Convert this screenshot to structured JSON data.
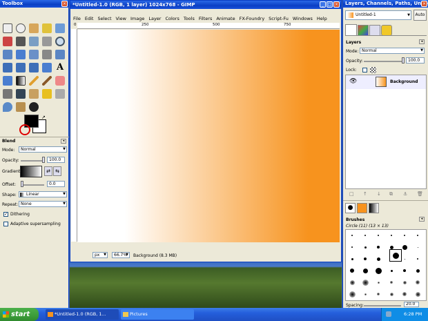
{
  "toolbox": {
    "title": "Toolbox"
  },
  "blend": {
    "title": "Blend",
    "mode_label": "Mode:",
    "mode_value": "Normal",
    "opacity_label": "Opacity:",
    "opacity_value": "100.0",
    "gradient_label": "Gradient:",
    "offset_label": "Offset:",
    "offset_value": "0.0",
    "shape_label": "Shape:",
    "shape_value": "Linear",
    "repeat_label": "Repeat:",
    "repeat_value": "None",
    "dithering_label": "Dithering",
    "dithering_checked": true,
    "adaptive_label": "Adaptive supersampling",
    "adaptive_checked": false
  },
  "image": {
    "title": "*Untitled-1.0 (RGB, 1 layer) 1024x768 - GIMP",
    "menu": [
      "File",
      "Edit",
      "Select",
      "View",
      "Image",
      "Layer",
      "Colors",
      "Tools",
      "Filters",
      "Animate",
      "FX-Foundry",
      "Script-Fu",
      "Windows",
      "Help"
    ],
    "ruler_ticks": [
      "0",
      "250",
      "500",
      "750"
    ],
    "unit": "px",
    "zoom": "66.7%",
    "status": "Background (8.3 MB)",
    "gradient_from": "#ffffff",
    "gradient_to": "#f7931e"
  },
  "layers_dock": {
    "title": "Layers, Channels, Paths, Undo -",
    "image_select": "Untitled-1",
    "auto_button": "Auto",
    "section_title": "Layers",
    "mode_label": "Mode:",
    "mode_value": "Normal",
    "opacity_label": "Opacity:",
    "opacity_value": "100.0",
    "lock_label": "Lock:",
    "layer_name": "Background"
  },
  "brushes": {
    "section_title": "Brushes",
    "brush_name": "Circle (11) (13 × 13)",
    "spacing_label": "Spacing:",
    "spacing_value": "20.0"
  },
  "taskbar": {
    "start": "start",
    "items": [
      "*Untitled-1.0 (RGB, 1...",
      "Pictures"
    ],
    "clock": "6:28 PM"
  },
  "colors": {
    "accent": "#f7931e",
    "titlebar": "#0a3fc4",
    "taskbar": "#245edb",
    "start": "#3c9c3a"
  }
}
